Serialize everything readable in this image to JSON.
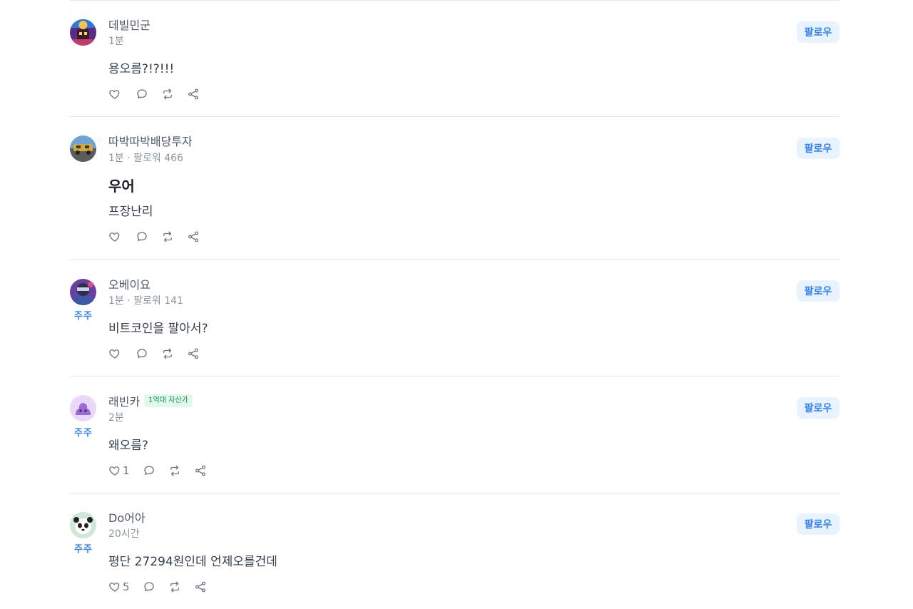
{
  "follow_label": "팔로우",
  "juju_label": "주주",
  "posts": [
    {
      "name": "데빌민군",
      "meta": "1분",
      "title": "",
      "content": "용오름?!?!!!",
      "likes": ""
    },
    {
      "name": "따박따박배당투자",
      "meta": "1분 · 팔로워 466",
      "title": "우어",
      "content": "프장난리",
      "likes": ""
    },
    {
      "name": "오베이요",
      "meta": "1분 · 팔로워 141",
      "title": "",
      "content": "비트코인을 팔아서?",
      "likes": ""
    },
    {
      "name": "래빈카",
      "badge": "1억대 자산가",
      "meta": "2분",
      "title": "",
      "content": "왜오름?",
      "likes": "1"
    },
    {
      "name": "Do어아",
      "meta": "20시간",
      "title": "",
      "content": "평단 27294원인데 언제오를건데",
      "likes": "5"
    }
  ],
  "colors": {
    "accent": "#3182f6",
    "follow_bg": "#e8f3ff",
    "divider": "#e5e8eb",
    "badge_green": "#0d8a4e"
  },
  "icons": [
    "heart-icon",
    "comment-icon",
    "repost-icon",
    "share-icon"
  ]
}
